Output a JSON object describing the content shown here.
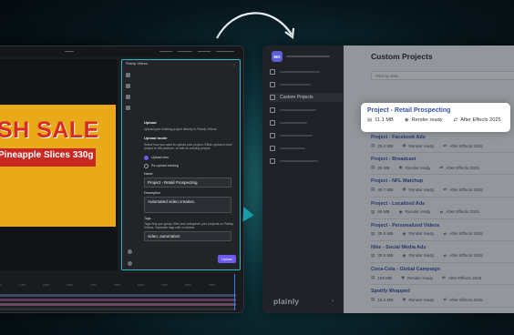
{
  "ae": {
    "artwork": {
      "sale_text": "SH SALE",
      "product_text": "Pineapple Slices 330g"
    },
    "panel": {
      "title": "Plainly Videos",
      "upload_heading": "Upload",
      "upload_desc": "Upload your existing project directly to Plainly Videos.",
      "upload_mode_heading": "Upload mode",
      "upload_mode_desc": "Select how you want to upload your project. Either upload a new project to the platform, or edit an existing project.",
      "option_new": "Upload new",
      "option_existing": "Re-upload existing",
      "name_label": "Name",
      "name_value": "Project - Retail Prospecting",
      "description_label": "Description",
      "description_value": "Automated video creation.",
      "tags_label": "Tags",
      "tags_desc": "Tags help you group, filter and categorize your projects on Plainly Videos. Separate tags with a comma.",
      "tags_value": "video, automation",
      "upload_button": "Upload"
    },
    "ruler_ticks": [
      "0:00f",
      "1:00f",
      "2:00f",
      "3:00f",
      "4:00f",
      "5:00f",
      "6:00f",
      "7:00f",
      "8:00f",
      "9:00f"
    ]
  },
  "app": {
    "avatar_initials": "MO",
    "sidebar_active": "Custom Projects",
    "brand": "plainly",
    "collapse_icon": "chevron-left-icon",
    "page_title": "Custom Projects",
    "filter_placeholder": "Filter by state",
    "highlighted": {
      "name": "Project - Retail Prospecting",
      "size": "11.1 MB",
      "status": "Render ready",
      "version": "After Effects 2025"
    },
    "projects": [
      {
        "name": "Project - Facebook Ads",
        "size": "26.4 MB",
        "status": "Render ready",
        "version": "After Effects 2025"
      },
      {
        "name": "Project - Broadcast",
        "size": "29 MB",
        "status": "Render ready",
        "version": "After Effects 2025"
      },
      {
        "name": "Project - NFL Matchup",
        "size": "40.7 MB",
        "status": "Render ready",
        "version": "After Effects 2025"
      },
      {
        "name": "Project - Localized Ads",
        "size": "69 MB",
        "status": "Render ready",
        "version": "After Effects 2025"
      },
      {
        "name": "Project - Personalized Videos",
        "size": "35.5 MB",
        "status": "Render ready",
        "version": "After Effects 2025"
      },
      {
        "name": "Nike - Social Media Ads",
        "size": "35.5 MB",
        "status": "Render ready",
        "version": "After Effects 2025"
      },
      {
        "name": "Coca-Cola - Global Campaign",
        "size": "150 MB",
        "status": "Render ready",
        "version": "After Effects 2025"
      },
      {
        "name": "Spotify Wrapped",
        "size": "15.2 MB",
        "status": "Render ready",
        "version": "After Effects 2025"
      }
    ]
  },
  "colors": {
    "accent": "#28b9c9",
    "button": "#6d5bf0",
    "link": "#3b4fa8"
  }
}
